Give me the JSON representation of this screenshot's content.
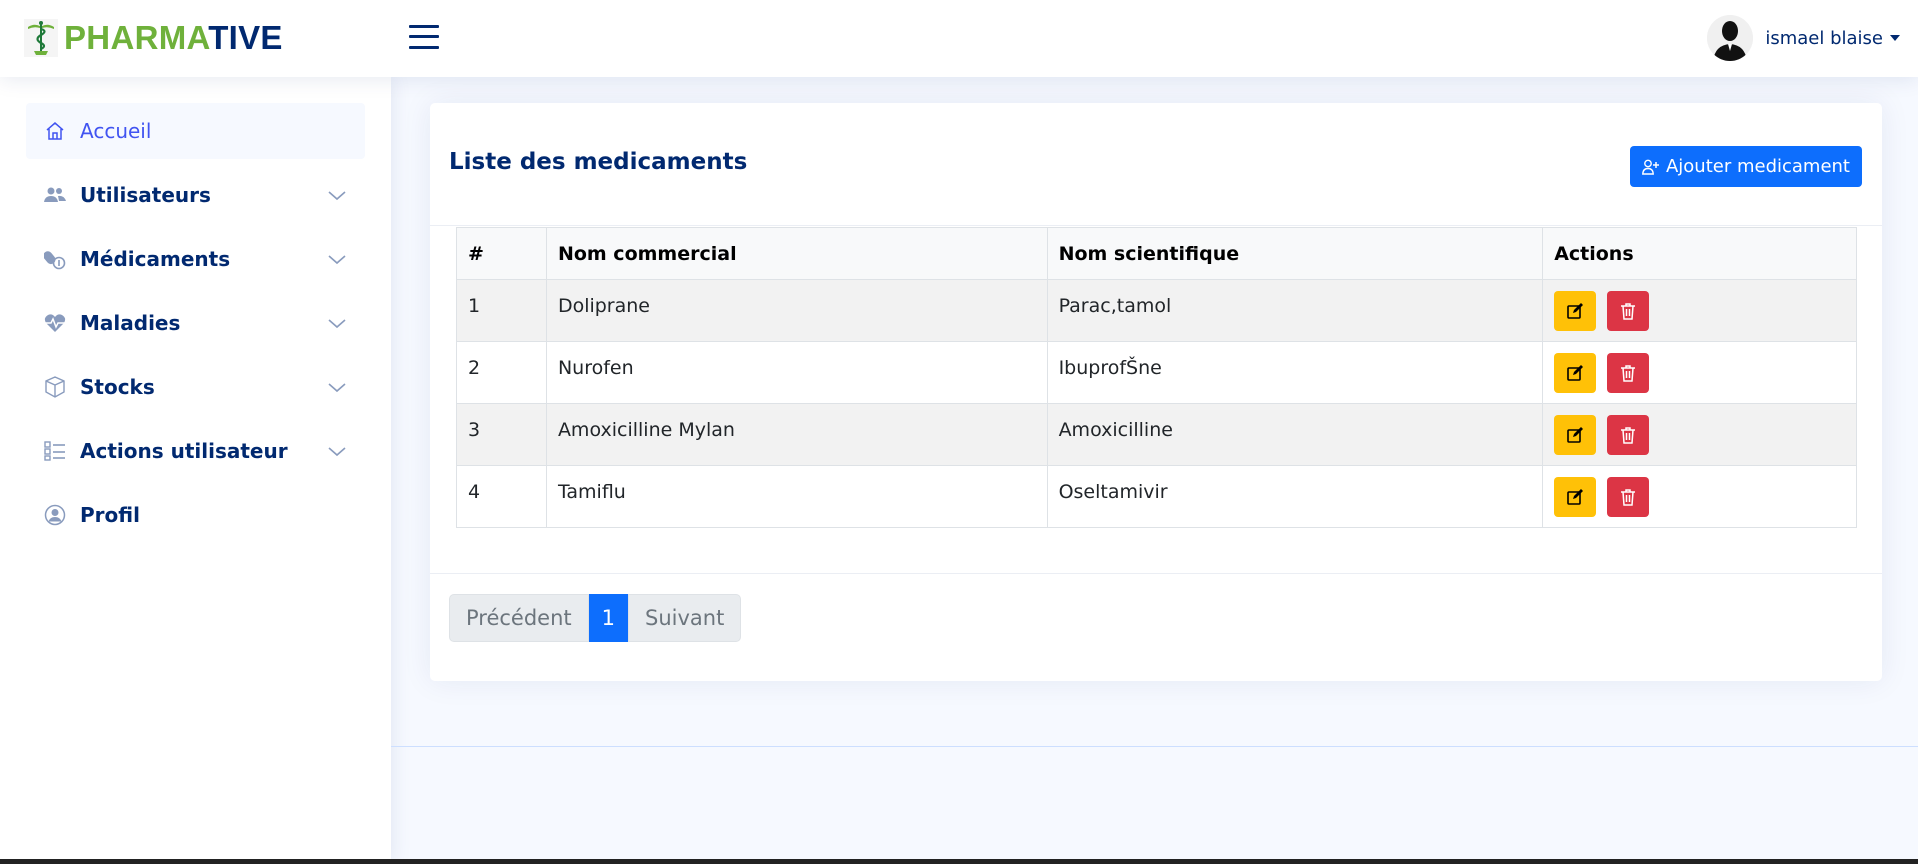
{
  "brand": {
    "part1": "PHARMA",
    "part2": "TIVE"
  },
  "header": {
    "user_name": "ismael blaise"
  },
  "sidebar": {
    "items": [
      {
        "label": "Accueil",
        "icon": "house-icon",
        "expandable": false,
        "active": true
      },
      {
        "label": "Utilisateurs",
        "icon": "people-icon",
        "expandable": true
      },
      {
        "label": "Médicaments",
        "icon": "capsule-icon",
        "expandable": true
      },
      {
        "label": "Maladies",
        "icon": "heart-pulse-icon",
        "expandable": true
      },
      {
        "label": "Stocks",
        "icon": "box-icon",
        "expandable": true
      },
      {
        "label": "Actions utilisateur",
        "icon": "list-check-icon",
        "expandable": true
      },
      {
        "label": "Profil",
        "icon": "person-circle-icon",
        "expandable": false
      }
    ]
  },
  "main": {
    "title": "Liste des medicaments",
    "add_button": "Ajouter medicament",
    "table": {
      "headers": [
        "#",
        "Nom commercial",
        "Nom scientifique",
        "Actions"
      ],
      "rows": [
        [
          "1",
          "Doliprane",
          "Parac,tamol"
        ],
        [
          "2",
          "Nurofen",
          "IbuprofŠne"
        ],
        [
          "3",
          "Amoxicilline Mylan",
          "Amoxicilline"
        ],
        [
          "4",
          "Tamiflu",
          "Oseltamivir"
        ]
      ]
    },
    "pagination": {
      "prev": "Précédent",
      "current": "1",
      "next": "Suivant"
    }
  },
  "colors": {
    "brand_green": "#6fb13b",
    "navy": "#012970",
    "primary": "#0d6efd",
    "warning": "#ffc107",
    "danger": "#dc3545"
  }
}
